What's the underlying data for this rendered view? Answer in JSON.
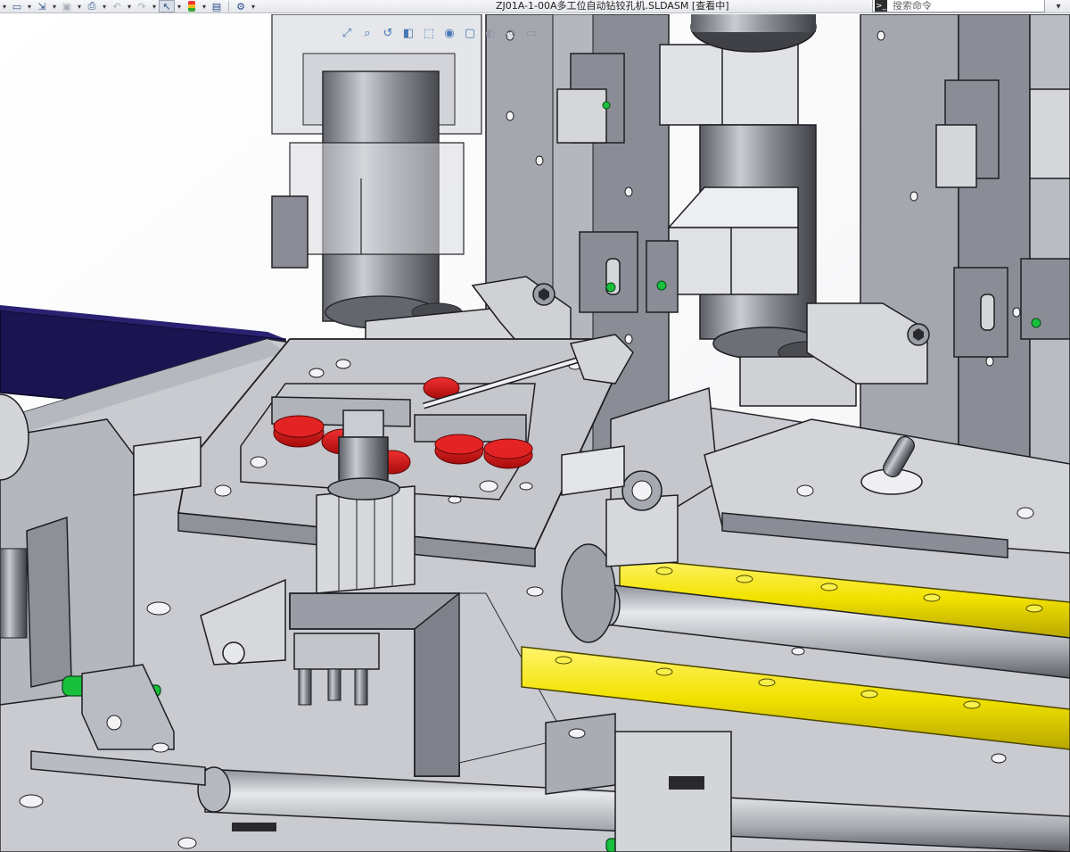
{
  "window": {
    "title": "ZJ01A-1-00A多工位自动钻铰孔机.SLDASM [查看中]"
  },
  "toolbar": {
    "buttons": [
      {
        "name": "new-icon",
        "glyph": "▭"
      },
      {
        "name": "open-icon",
        "glyph": "⇲"
      },
      {
        "name": "save-icon",
        "glyph": "▣"
      },
      {
        "name": "print-icon",
        "glyph": "⎙"
      },
      {
        "name": "undo-icon",
        "glyph": "↶"
      },
      {
        "name": "redo-icon",
        "glyph": "↷"
      },
      {
        "name": "select-icon",
        "glyph": "↖"
      },
      {
        "name": "rebuild-icon",
        "glyph": "●"
      },
      {
        "name": "file-properties-icon",
        "glyph": "▤"
      },
      {
        "name": "options-icon",
        "glyph": "⚙"
      }
    ]
  },
  "command_search": {
    "placeholder": "搜索命令"
  },
  "hud": {
    "tools": [
      "zoom-to-fit-icon",
      "zoom-area-icon",
      "previous-view-icon",
      "section-view-icon",
      "view-orientation-icon",
      "display-style-icon",
      "hide-show-icon",
      "edit-appearance-icon",
      "apply-scene-icon",
      "view-settings-icon"
    ]
  },
  "colors": {
    "metal_light": "#d2d4d8",
    "metal_mid": "#aeb1b7",
    "metal_dark": "#7d8088",
    "panel_gray": "#9a9da5",
    "red_part": "#d01515",
    "yellow_rail": "#f2e200",
    "green_fitting": "#18c03c",
    "navy_beam": "#1a1450",
    "outline": "#1e1e22",
    "glass": "#c9ccd6"
  }
}
